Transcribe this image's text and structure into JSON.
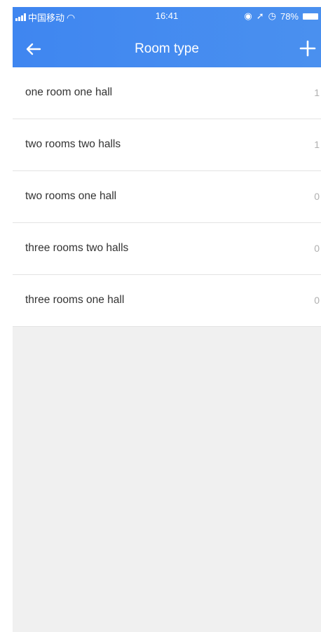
{
  "status_bar": {
    "carrier": "中国移动",
    "time": "16:41",
    "battery": "78%"
  },
  "header": {
    "title": "Room type",
    "back_icon": "arrow-left-icon",
    "add_icon": "plus-icon"
  },
  "rooms": [
    {
      "label": "one room one hall",
      "count": "1"
    },
    {
      "label": "two rooms two halls",
      "count": "1"
    },
    {
      "label": "two rooms one hall",
      "count": "0"
    },
    {
      "label": "three rooms two halls",
      "count": "0"
    },
    {
      "label": "three rooms one hall",
      "count": "0"
    }
  ],
  "colors": {
    "header": "#4a90ef",
    "background": "#f0f0f0"
  }
}
